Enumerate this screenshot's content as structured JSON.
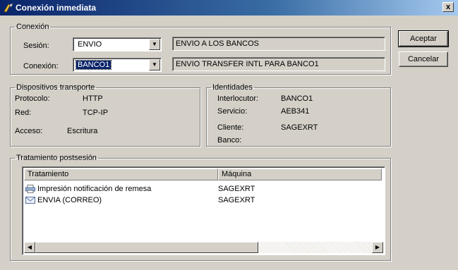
{
  "window": {
    "title": "Conexión inmediata",
    "close_label": "x"
  },
  "conexion_group": {
    "legend": "Conexión",
    "sesion_label": "Sesión:",
    "sesion_value": "ENVIO",
    "sesion_description": "ENVIO A LOS BANCOS",
    "conexion_label": "Conexión:",
    "conexion_value": "BANCO1",
    "conexion_description": "ENVIO TRANSFER INTL PARA BANCO1"
  },
  "buttons": {
    "accept_label": "Aceptar",
    "cancel_label": "Cancelar"
  },
  "dispositivos": {
    "legend": "Dispositivos transporte",
    "protocolo_label": "Protocolo:",
    "protocolo_value": "HTTP",
    "red_label": "Red:",
    "red_value": "TCP-IP",
    "acceso_label": "Acceso:",
    "acceso_value": "Escritura"
  },
  "identidades": {
    "legend": "Identidades",
    "interlocutor_label": "Interlocutor:",
    "interlocutor_value": "BANCO1",
    "servicio_label": "Servicio:",
    "servicio_value": "AEB341",
    "cliente_label": "Cliente:",
    "cliente_value": "SAGEXRT",
    "banco_label": "Banco:",
    "banco_value": ""
  },
  "tratamiento": {
    "legend": "Tratamiento postsesión",
    "columns": [
      "Tratamiento",
      "Máquina"
    ],
    "rows": [
      {
        "tratamiento": "Impresión notificación de remesa",
        "maquina": "SAGEXRT",
        "icon": "printer-icon"
      },
      {
        "tratamiento": "ENVIA (CORREO)",
        "maquina": "SAGEXRT",
        "icon": "mail-icon"
      }
    ]
  },
  "colors": {
    "titlebar_start": "#0a246a",
    "titlebar_end": "#a6caf0",
    "face": "#d4d0c8",
    "selection": "#0a246a"
  }
}
